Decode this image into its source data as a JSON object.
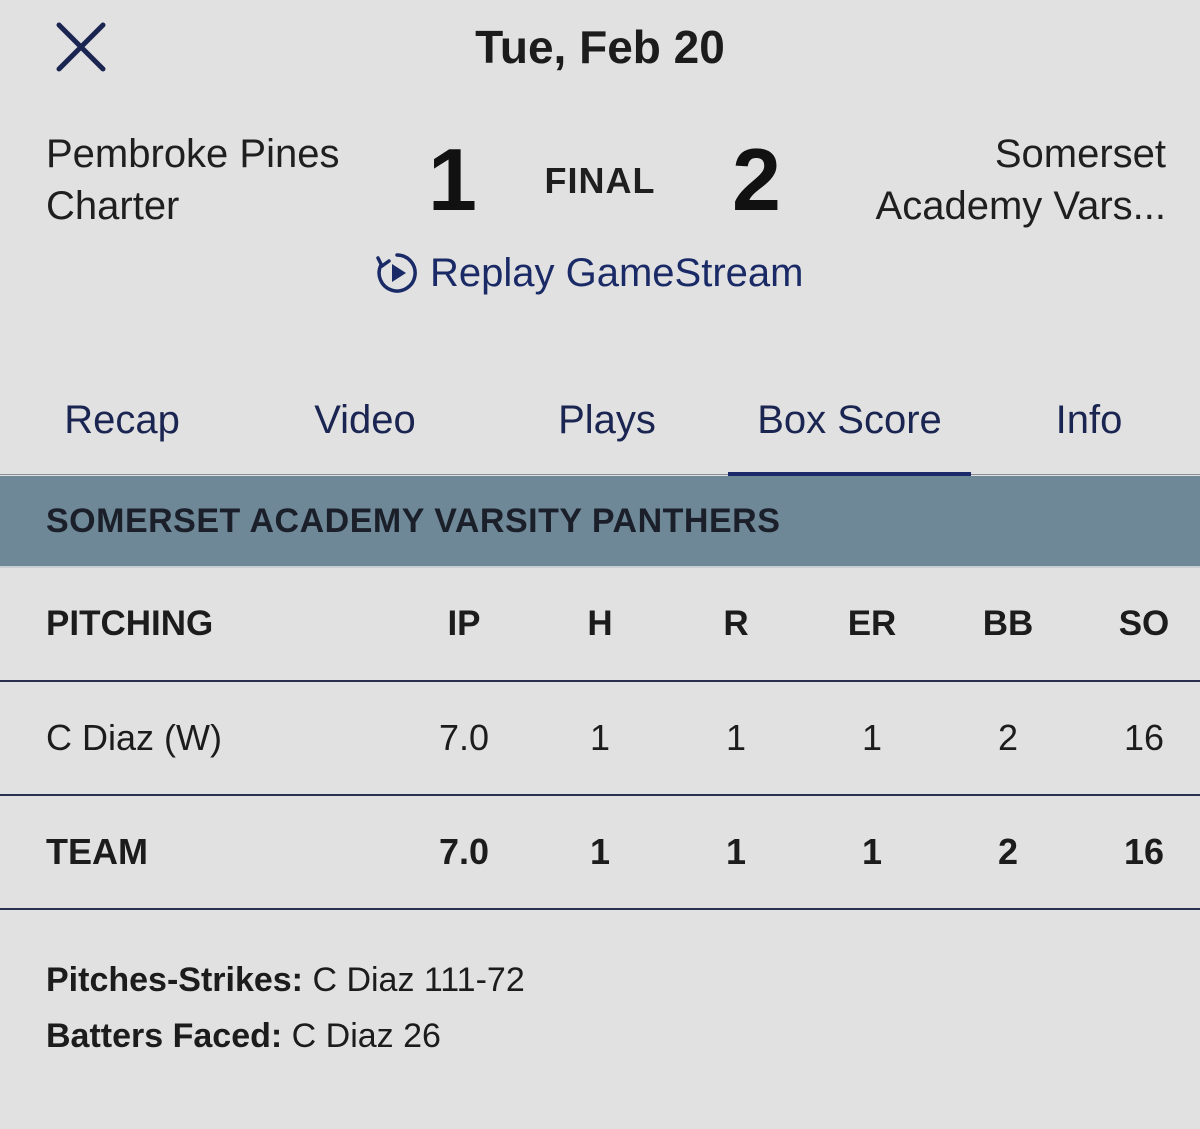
{
  "header": {
    "date": "Tue, Feb 20",
    "close_icon": "close-icon"
  },
  "game": {
    "home_team": "Pembroke Pines Charter",
    "home_score": "1",
    "status": "FINAL",
    "away_score": "2",
    "away_team": "Somerset Academy Vars..."
  },
  "replay": {
    "label": "Replay GameStream",
    "icon": "replay-icon"
  },
  "tabs": [
    {
      "label": "Recap"
    },
    {
      "label": "Video"
    },
    {
      "label": "Plays"
    },
    {
      "label": "Box Score",
      "active": true
    },
    {
      "label": "Info"
    }
  ],
  "section": {
    "team_title": "SOMERSET ACADEMY VARSITY PANTHERS"
  },
  "pitching": {
    "columns": [
      "PITCHING",
      "IP",
      "H",
      "R",
      "ER",
      "BB",
      "SO"
    ],
    "rows": [
      {
        "name": "C Diaz (W)",
        "ip": "7.0",
        "h": "1",
        "r": "1",
        "er": "1",
        "bb": "2",
        "so": "16"
      }
    ],
    "total": {
      "name": "TEAM",
      "ip": "7.0",
      "h": "1",
      "r": "1",
      "er": "1",
      "bb": "2",
      "so": "16"
    }
  },
  "notes": [
    {
      "label": "Pitches-Strikes:",
      "value": " C Diaz 111-72"
    },
    {
      "label": "Batters Faced:",
      "value": " C Diaz 26"
    }
  ],
  "colors": {
    "background": "#e1e1e1",
    "accent": "#1b2a6b",
    "section_header": "#6e8898"
  }
}
